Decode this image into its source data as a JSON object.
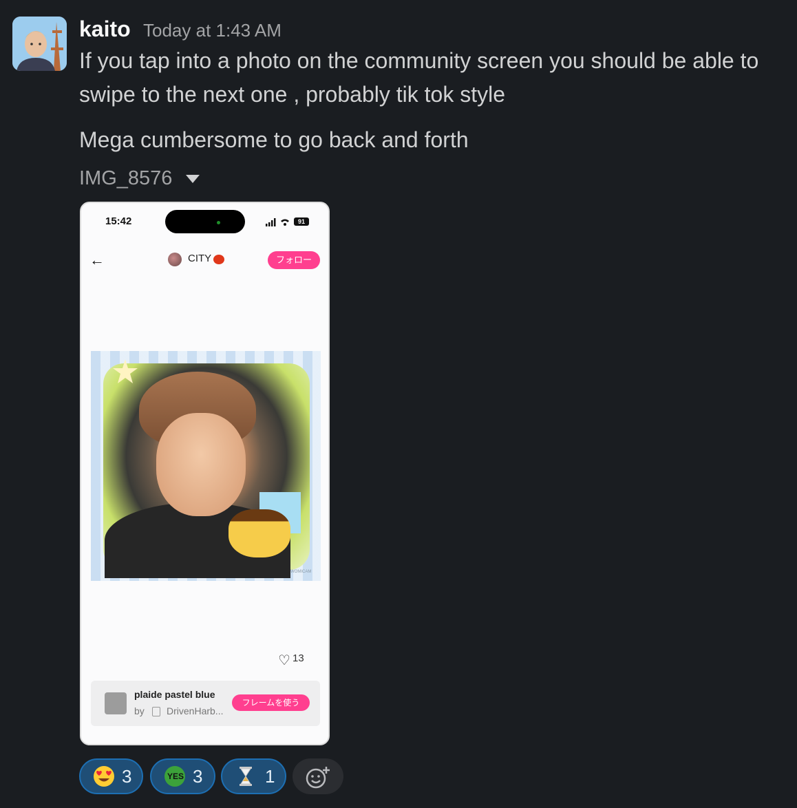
{
  "message": {
    "username": "kaito",
    "timestamp": "Today at 1:43 AM",
    "lines": [
      "If you tap into a photo on the community screen you should be able to",
      "swipe to the next one , probably tik tok style",
      "Mega cumbersome to go back and forth"
    ],
    "file_name": "IMG_8576"
  },
  "screenshot": {
    "status_time": "15:42",
    "battery": "91",
    "account_name": "CITY",
    "follow_label": "フォロー",
    "like_count": "13",
    "frame_title": "plaide pastel blue",
    "frame_by": "by",
    "frame_author": "DrivenHarb...",
    "frame_button": "フレームを使う",
    "watermark": "WOMICAM"
  },
  "reactions": [
    {
      "emoji": "heart-eyes-icon",
      "count": "3"
    },
    {
      "emoji": "yes-icon",
      "count": "3",
      "label": "YES"
    },
    {
      "emoji": "hourglass-icon",
      "count": "1"
    }
  ],
  "colors": {
    "background": "#1a1d21",
    "reaction_bg": "#1f4e76",
    "reaction_border": "#1d6fb3",
    "accent_pink": "#ff3f8f"
  }
}
